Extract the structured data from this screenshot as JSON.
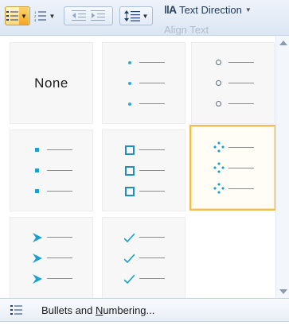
{
  "ribbon": {
    "text_direction_label": "Text Direction",
    "align_text_partial": "Align Text"
  },
  "gallery": {
    "none_label": "None",
    "tiles": [
      {
        "name": "none",
        "icon": "none"
      },
      {
        "name": "small-dot",
        "icon": "dot-bullet-icon"
      },
      {
        "name": "hollow-circle",
        "icon": "hollow-circle-bullet-icon"
      },
      {
        "name": "filled-square",
        "icon": "filled-square-bullet-icon"
      },
      {
        "name": "hollow-square",
        "icon": "hollow-square-bullet-icon"
      },
      {
        "name": "four-diamond",
        "icon": "diamond-cluster-bullet-icon",
        "selected": true
      },
      {
        "name": "arrowhead",
        "icon": "arrowhead-bullet-icon"
      },
      {
        "name": "checkmark",
        "icon": "checkmark-bullet-icon"
      }
    ]
  },
  "footer": {
    "label_before": "Bullets and ",
    "label_mnemonic": "N",
    "label_after": "umbering..."
  },
  "colors": {
    "bullet_accent": "#1aa0cf",
    "selection_border": "#f0bd55",
    "ribbon_bg": "#dbe6f4"
  }
}
